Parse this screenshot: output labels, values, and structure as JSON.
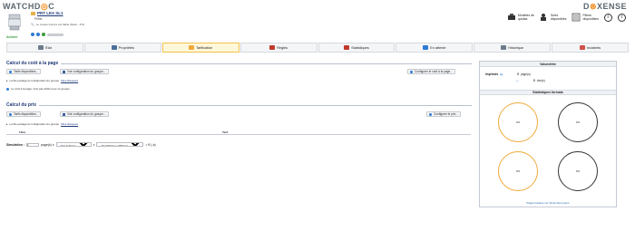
{
  "brand": {
    "left_prefix": "WATCHD",
    "left_x": "◎",
    "left_suffix": "C",
    "right_prefix": "D",
    "right_x": "⊗",
    "right_suffix": "XENSE"
  },
  "printer": {
    "name": "PRT LEX SL1",
    "sub": "Prête.",
    "warning": "Le niveau d'encre est faible (black - 4%).",
    "status": "Activée"
  },
  "top_actions": [
    {
      "label": "Modèles de\nquotas"
    },
    {
      "label": "Sorts\ndisponibles"
    },
    {
      "label": "Filtres\ndisponibles"
    }
  ],
  "tabs": [
    {
      "label": "État",
      "color": "#6b7a8a",
      "active": false
    },
    {
      "label": "Propriétés",
      "color": "#4a6e99",
      "active": false
    },
    {
      "label": "Tarification",
      "color": "#f0a93a",
      "active": true
    },
    {
      "label": "Règles",
      "color": "#c0392b",
      "active": false
    },
    {
      "label": "Statistiques",
      "color": "#c0392b",
      "active": false
    },
    {
      "label": "En attente",
      "color": "#2e7bd6",
      "active": false
    },
    {
      "label": "Historique",
      "color": "#6b7a8a",
      "active": false
    },
    {
      "label": "Incidents",
      "color": "#d0524a",
      "active": false
    }
  ],
  "cost_section": {
    "title": "Calcul du coût à la page",
    "btn_tarifs": "Tarifs disponibles...",
    "btn_config": "Voir configuration du groupe...",
    "btn_configure": "Configurer le coût à la page...",
    "note1_prefix": "La file partage la configuration du groupe",
    "note1_link": "Files Réseaux",
    "note2": "Le coût à la page n'est pas défini pour ce groupe."
  },
  "price_section": {
    "title": "Calcul du prix",
    "btn_tarifs": "Tarifs disponibles...",
    "btn_config": "Voir configuration du groupe...",
    "btn_configure": "Configurer le prix...",
    "note1_prefix": "La file partage la configuration du groupe",
    "note1_link": "Files Réseaux",
    "col_filters": "Filtre",
    "col_tariff": "Tarif"
  },
  "simulation": {
    "label": "Simulation :",
    "pages_value": "1",
    "pages_suffix": "page(s) x",
    "color_option": "Noir & blanc",
    "x_sep": "x",
    "format_option": "A4 (210mm x 297mm)",
    "result": "= € ( a)"
  },
  "volumetry": {
    "title": "Volumétrie",
    "row1_label": "Imprimés",
    "row1_value": "0",
    "row1_unit": "page(s)",
    "row2_value": "0",
    "row2_unit": "doc(s)",
    "stats_title": "Statistiques formats",
    "circles": [
      "0%",
      "0%",
      "0%",
      "0%"
    ],
    "footer": "Pages traitées sur 30 derniers jours"
  }
}
